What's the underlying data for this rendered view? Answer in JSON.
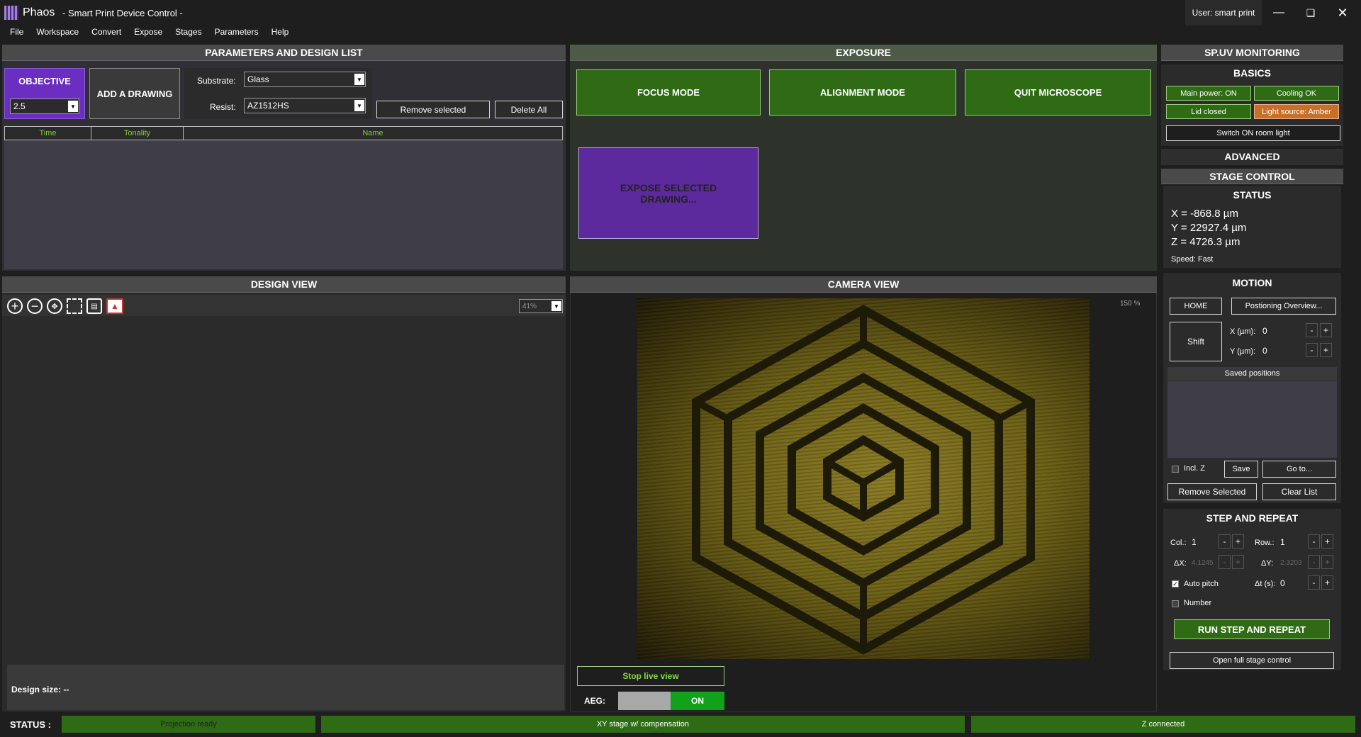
{
  "titlebar": {
    "app": "Phaos",
    "title": "- Smart Print Device Control -",
    "user": "User: smart print"
  },
  "menu": [
    "File",
    "Workspace",
    "Convert",
    "Expose",
    "Stages",
    "Parameters",
    "Help"
  ],
  "params": {
    "header": "PARAMETERS AND DESIGN LIST",
    "objective_label": "OBJECTIVE",
    "objective_value": "2.5",
    "add_drawing": "ADD A DRAWING",
    "substrate_label": "Substrate:",
    "substrate_value": "Glass",
    "resist_label": "Resist:",
    "resist_value": "AZ1512HS",
    "remove_selected": "Remove selected",
    "delete_all": "Delete All",
    "columns": [
      "Time",
      "Tonality",
      "Name"
    ]
  },
  "exposure": {
    "header": "EXPOSURE",
    "focus_mode": "FOCUS MODE",
    "alignment_mode": "ALIGNMENT MODE",
    "quit_microscope": "QUIT MICROSCOPE",
    "expose_selected": "EXPOSE SELECTED DRAWING..."
  },
  "design_view": {
    "header": "DESIGN VIEW",
    "zoom": "41%",
    "design_size": "Design size: --"
  },
  "camera_view": {
    "header": "CAMERA VIEW",
    "zoom": "150 %",
    "stop_live": "Stop live view",
    "aeg_label": "AEG:",
    "aeg_state": "ON"
  },
  "monitoring": {
    "header": "SP.UV MONITORING",
    "basics": "BASICS",
    "main_power": "Main power: ON",
    "cooling": "Cooling OK",
    "lid": "Lid closed",
    "light_source": "Light source: Amber",
    "room_light": "Switch ON room light",
    "advanced": "ADVANCED"
  },
  "stage": {
    "header": "STAGE CONTROL",
    "status": "STATUS",
    "x": "X = -868.8 µm",
    "y": "Y = 22927.4 µm",
    "z": "Z = 4726.3 µm",
    "speed": "Speed: Fast",
    "motion": "MOTION",
    "home": "HOME",
    "positioning": "Postioning Overview...",
    "shift": "Shift",
    "x_label": "X (µm):",
    "x_value": "0",
    "y_label": "Y (µm):",
    "y_value": "0",
    "saved_positions": "Saved positions",
    "incl_z": "Incl. Z",
    "save": "Save",
    "goto": "Go to...",
    "remove_selected": "Remove Selected",
    "clear_list": "Clear List"
  },
  "step_repeat": {
    "header": "STEP AND REPEAT",
    "col_label": "Col.:",
    "col_value": "1",
    "row_label": "Row.:",
    "row_value": "1",
    "dx_label": "ΔX:",
    "dx_value": "4.1245",
    "dy_label": "ΔY:",
    "dy_value": "2.3203",
    "auto_pitch": "Auto pitch",
    "dt_label": "Δt (s):",
    "dt_value": "0",
    "number": "Number",
    "run": "RUN STEP AND REPEAT",
    "open_full": "Open full stage control"
  },
  "statusbar": {
    "label": "STATUS :",
    "projection": "Projection ready",
    "xy": "XY stage w/ compensation",
    "z": "Z connected"
  },
  "colors": {
    "green": "#2e6b14",
    "purple": "#5c2a9d",
    "amber": "#c8702a",
    "bg": "#1e1e1e"
  }
}
